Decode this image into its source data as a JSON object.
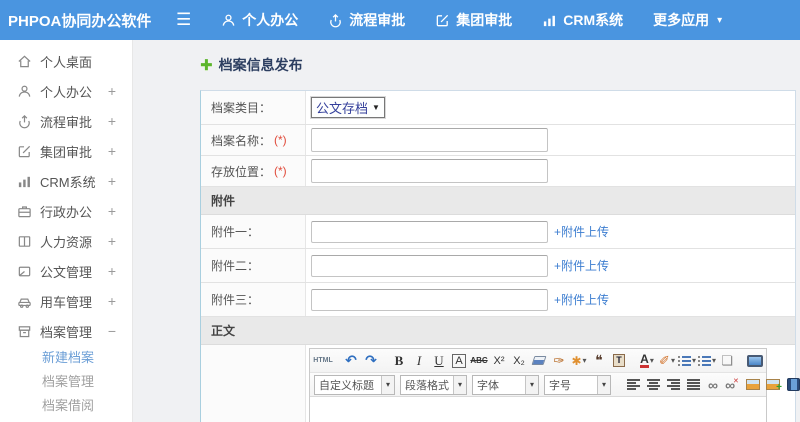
{
  "header": {
    "logo": "PHPOA协同办公软件",
    "hamburger": "☰",
    "menu_items": [
      {
        "label": "个人办公"
      },
      {
        "label": "流程审批"
      },
      {
        "label": "集团审批"
      },
      {
        "label": "CRM系统"
      },
      {
        "label": "更多应用"
      }
    ],
    "more_caret": "▾"
  },
  "sidebar": {
    "items": [
      {
        "label": "个人桌面",
        "expand": ""
      },
      {
        "label": "个人办公",
        "expand": "+"
      },
      {
        "label": "流程审批",
        "expand": "+"
      },
      {
        "label": "集团审批",
        "expand": "+"
      },
      {
        "label": "CRM系统",
        "expand": "+"
      },
      {
        "label": "行政办公",
        "expand": "+"
      },
      {
        "label": "人力资源",
        "expand": "+"
      },
      {
        "label": "公文管理",
        "expand": "+"
      },
      {
        "label": "用车管理",
        "expand": "+"
      },
      {
        "label": "档案管理",
        "expand": "−"
      }
    ],
    "submenu": [
      {
        "label": "新建档案"
      },
      {
        "label": "档案管理"
      },
      {
        "label": "档案借阅"
      }
    ]
  },
  "page": {
    "title": "档案信息发布",
    "title_icon": "✚"
  },
  "form": {
    "category_label": "档案类目：",
    "category_value": "公文存档",
    "category_caret": "▼",
    "name_label": "档案名称：",
    "location_label": "存放位置：",
    "required": "(*)",
    "attachments_header": "附件",
    "attachments": [
      {
        "label": "附件一："
      },
      {
        "label": "附件二："
      },
      {
        "label": "附件三："
      }
    ],
    "upload_link": "+附件上传",
    "body_header": "正文"
  },
  "editor": {
    "buttons": {
      "html": "HTML",
      "undo": "↶",
      "redo": "↷",
      "bold": "B",
      "italic": "I",
      "underline": "U",
      "font_name": "A",
      "strikethrough": "ABC",
      "superscript": "X²",
      "subscript": "X₂",
      "brush": "✑",
      "wand": "✱",
      "quote": "❝",
      "paste_t": "T",
      "font_color": "A",
      "highlight": "✐",
      "page": "❏",
      "link": "∞",
      "unlink": "∞",
      "unlink_x": "✕",
      "plus": "+",
      "caret": "▾"
    },
    "selects": [
      {
        "label": "自定义标题"
      },
      {
        "label": "段落格式"
      },
      {
        "label": "字体"
      },
      {
        "label": "字号"
      }
    ]
  },
  "colors": {
    "header_bg": "#4a95e0",
    "link_blue": "#3d7ed0",
    "title_color": "#2c3e60",
    "required_red": "#e04a3a",
    "select_text": "#333f9b",
    "green_plus": "#5cb52c",
    "section_header_bg": "#e9e9e9"
  }
}
